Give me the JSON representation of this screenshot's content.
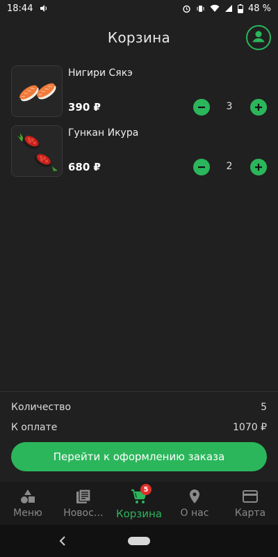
{
  "status_bar": {
    "time": "18:44",
    "battery": "48 %",
    "left_icons": [
      "volume-icon"
    ],
    "right_icons": [
      "alarm-icon",
      "vibrate-icon",
      "wifi-icon",
      "signal-icon",
      "battery-icon"
    ]
  },
  "header": {
    "title": "Корзина",
    "profile_icon": "profile-icon"
  },
  "cart": {
    "items": [
      {
        "name": "Нигири Сякэ",
        "price": "390 ₽",
        "quantity": "3",
        "image": "nigiri-salmon"
      },
      {
        "name": "Гункан Икура",
        "price": "680 ₽",
        "quantity": "2",
        "image": "gunkan-ikura"
      }
    ]
  },
  "summary": {
    "count_label": "Количество",
    "count_value": "5",
    "total_label": "К оплате",
    "total_value": "1070 ₽",
    "checkout_label": "Перейти к оформлению заказа"
  },
  "bottom_nav": {
    "items": [
      {
        "label": "Меню",
        "icon": "shapes-icon",
        "active": false
      },
      {
        "label": "Новос…",
        "icon": "news-icon",
        "active": false
      },
      {
        "label": "Корзина",
        "icon": "cart-icon",
        "active": true,
        "badge": "5"
      },
      {
        "label": "О нас",
        "icon": "location-pin-icon",
        "active": false
      },
      {
        "label": "Карта",
        "icon": "card-icon",
        "active": false
      }
    ]
  },
  "colors": {
    "accent": "#2bb65b",
    "background": "#202020",
    "nav_background": "#1a1a1a",
    "badge": "#e0302a"
  }
}
